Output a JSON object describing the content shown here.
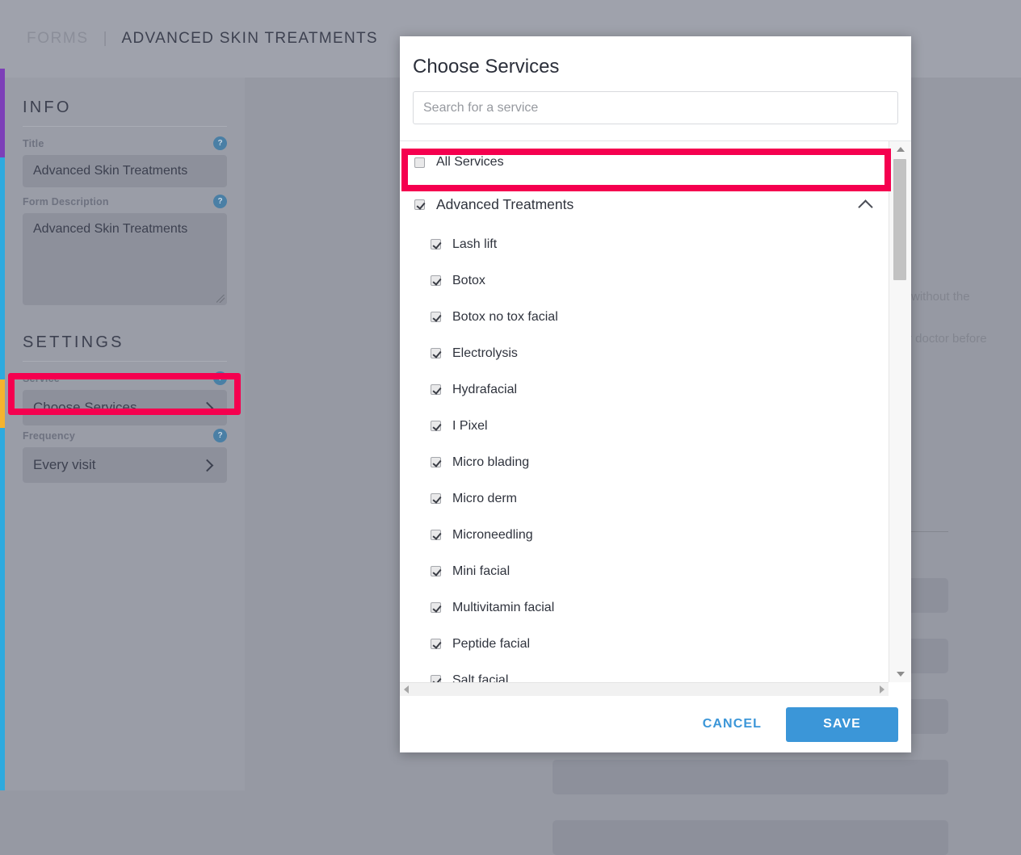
{
  "header": {
    "breadcrumb_root": "FORMS",
    "breadcrumb_separator": "|",
    "breadcrumb_current": "ADVANCED SKIN TREATMENTS"
  },
  "sidebar": {
    "info": {
      "section_title": "INFO",
      "title_label": "Title",
      "title_value": "Advanced Skin Treatments",
      "description_label": "Form Description",
      "description_value": "Advanced Skin Treatments",
      "help_glyph": "?"
    },
    "settings": {
      "section_title": "SETTINGS",
      "service_label": "Service",
      "service_value": "Choose Services",
      "frequency_label": "Frequency",
      "frequency_value": "Every visit",
      "help_glyph": "?"
    },
    "accent_colors": [
      "#7d3fb8",
      "#2eaade",
      "#f5b32e",
      "#2eaade"
    ]
  },
  "background": {
    "text_fragment_1": "without the",
    "text_fragment_2": "r doctor before"
  },
  "modal": {
    "title": "Choose Services",
    "search_placeholder": "Search for a service",
    "search_value": "",
    "all_services_label": "All Services",
    "all_services_checked": false,
    "group": {
      "label": "Advanced Treatments",
      "checked": true,
      "expanded": true
    },
    "services": [
      {
        "label": "Lash lift",
        "checked": true
      },
      {
        "label": "Botox",
        "checked": true
      },
      {
        "label": "Botox no tox facial",
        "checked": true
      },
      {
        "label": "Electrolysis",
        "checked": true
      },
      {
        "label": "Hydrafacial",
        "checked": true
      },
      {
        "label": "I Pixel",
        "checked": true
      },
      {
        "label": "Micro blading",
        "checked": true
      },
      {
        "label": "Micro derm",
        "checked": true
      },
      {
        "label": "Microneedling",
        "checked": true
      },
      {
        "label": "Mini facial",
        "checked": true
      },
      {
        "label": "Multivitamin facial",
        "checked": true
      },
      {
        "label": "Peptide facial",
        "checked": true
      },
      {
        "label": "Salt facial",
        "checked": true
      }
    ],
    "cancel_label": "CANCEL",
    "save_label": "SAVE"
  },
  "highlight_color": "#f5004f",
  "accent_color": "#3b96d8"
}
